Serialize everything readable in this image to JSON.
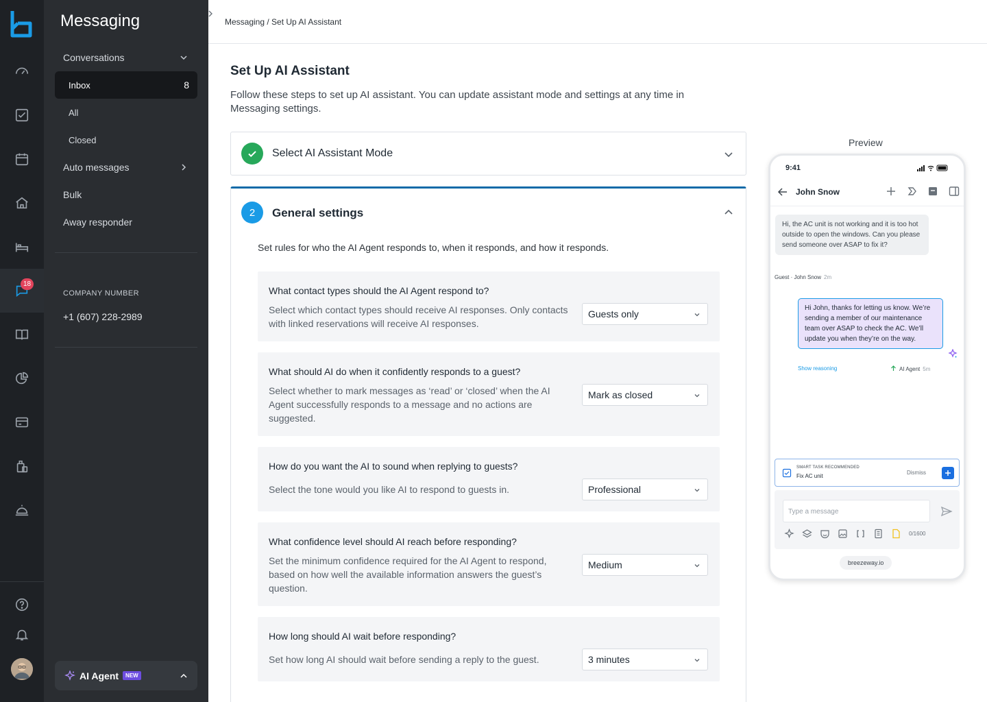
{
  "nav": {
    "title": "Messaging",
    "conversations": "Conversations",
    "inbox": "Inbox",
    "inbox_count": "8",
    "all": "All",
    "closed": "Closed",
    "auto_messages": "Auto messages",
    "bulk": "Bulk",
    "away_responder": "Away responder",
    "company_label": "COMPANY NUMBER",
    "company_number": "+1 (607) 228-2989",
    "ai_agent": "AI Agent",
    "ai_agent_badge": "NEW"
  },
  "rail": {
    "messages_badge": "18",
    "icons": [
      "dashboard-icon",
      "tasks-icon",
      "calendar-icon",
      "home-icon",
      "bed-icon",
      "messages-icon",
      "guidebook-icon",
      "reports-icon",
      "billing-icon",
      "inventory-icon",
      "service-bell-icon",
      "help-icon",
      "notifications-icon"
    ]
  },
  "breadcrumb": "Messaging / Set Up AI Assistant",
  "page": {
    "title": "Set Up AI Assistant",
    "description": "Follow these steps to set up AI assistant. You can update assistant mode and settings at any time in Messaging settings."
  },
  "step1": {
    "label": "Select AI Assistant Mode"
  },
  "step2": {
    "number": "2",
    "label": "General settings",
    "intro": "Set rules for who the AI Agent responds to, when it responds, and how it responds.",
    "questions": [
      {
        "q": "What contact types should the AI Agent respond to?",
        "d": "Select which contact types should receive AI responses. Only contacts with linked reservations will receive AI responses.",
        "value": "Guests only"
      },
      {
        "q": "What should AI do when it confidently responds to a guest?",
        "d": "Select whether to mark messages as ‘read’ or ‘closed’ when the AI Agent successfully responds to a message and no actions are suggested.",
        "value": "Mark as closed"
      },
      {
        "q": "How do you want the AI to sound when replying to guests?",
        "d": "Select the tone would you like AI to respond to guests in.",
        "value": "Professional"
      },
      {
        "q": "What confidence level should AI reach before responding?",
        "d": "Set the minimum confidence required for the AI Agent to respond, based on how well the available information answers the guest’s question.",
        "value": "Medium"
      },
      {
        "q": "How long should AI wait before responding?",
        "d": "Set how long AI should wait before sending a reply to the guest.",
        "value": "3 minutes"
      }
    ]
  },
  "preview": {
    "label": "Preview",
    "time": "9:41",
    "contact": "John Snow",
    "guest_message": "Hi, the AC unit is not working and it is too hot outside to open the windows. Can you please send someone over ASAP to fix it?",
    "guest_meta": "Guest · John Snow",
    "guest_time": "2m",
    "ai_message": "Hi John, thanks for letting us know. We’re sending a member of our maintenance team over ASAP to check the AC. We’ll update you when they’re on the way.",
    "show_reasoning": "Show reasoning",
    "ai_meta": "AI Agent",
    "ai_time": "5m",
    "smart_task_label": "SMART TASK RECOMMENDED",
    "smart_task_title": "Fix AC unit",
    "dismiss": "Dismiss",
    "input_placeholder": "Type a message",
    "char_counter": "0/1600",
    "domain": "breezeway.io"
  },
  "colors": {
    "rail_bg": "#1e2125",
    "nav_bg": "#2a2d31",
    "accent_blue": "#1a9be6",
    "step_border": "#0e6aa8",
    "success": "#27a85a",
    "badge_red": "#e2445c",
    "ai_purple": "#6d4de0"
  }
}
